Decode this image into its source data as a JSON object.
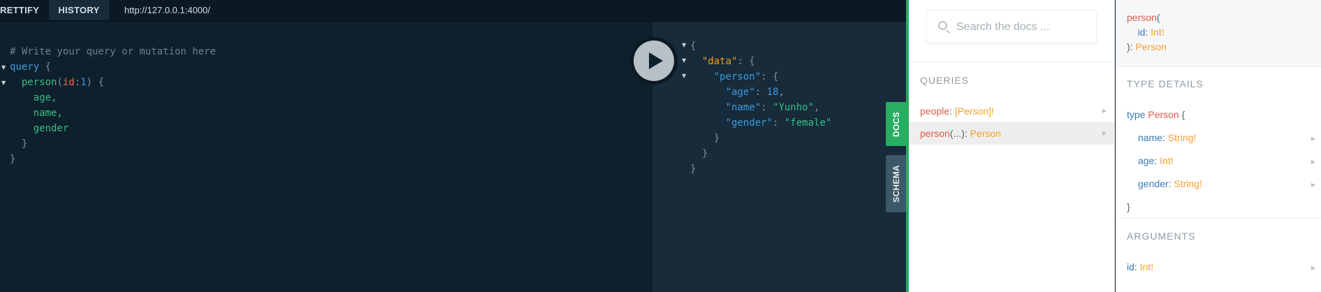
{
  "toolbar": {
    "prettify_label": "RETTIFY",
    "history_label": "HISTORY",
    "url": "http://127.0.0.1:4000/"
  },
  "query_editor": {
    "comment": "# Write your query or mutation here",
    "keyword": "query",
    "open_brace": " {",
    "field": "person",
    "arg_open": "(",
    "arg_name": "id",
    "arg_colon": ":",
    "arg_value": "1",
    "arg_close": ") {",
    "sub_fields": [
      "age,",
      "name,",
      "gender"
    ],
    "close_inner": "}",
    "close_outer": "}"
  },
  "result": {
    "open": "{",
    "data_key": "\"data\"",
    "person_key": "\"person\"",
    "age_key": "\"age\"",
    "age_value": "18",
    "name_key": "\"name\"",
    "name_value": "\"Yunho\"",
    "gender_key": "\"gender\"",
    "gender_value": "\"female\"",
    "colon_brace": ": {",
    "colon": ": ",
    "comma": ",",
    "close": "}"
  },
  "side_tabs": {
    "docs": "DOCS",
    "schema": "SCHEMA"
  },
  "docs": {
    "search_placeholder": "Search the docs ...",
    "queries_title": "QUERIES",
    "queries": [
      {
        "name": "people",
        "sep": ": ",
        "type": "[Person]!"
      },
      {
        "name": "person",
        "args": "(...)",
        "sep": ": ",
        "type": "Person"
      }
    ],
    "signature": {
      "name": "person",
      "open": "(",
      "arg_name": "id",
      "arg_sep": ": ",
      "arg_type": "Int!",
      "close": "): ",
      "return_type": "Person"
    },
    "type_details_title": "TYPE DETAILS",
    "type_keyword": "type",
    "type_name": "Person",
    "type_open": " {",
    "type_fields": [
      {
        "name": "name",
        "sep": ": ",
        "type": "String!"
      },
      {
        "name": "age",
        "sep": ": ",
        "type": "Int!"
      },
      {
        "name": "gender",
        "sep": ": ",
        "type": "String!"
      }
    ],
    "type_close": "}",
    "arguments_title": "ARGUMENTS",
    "arguments": [
      {
        "name": "id",
        "sep": ": ",
        "type": "Int!"
      }
    ]
  },
  "colors": {
    "docs_tab": "#27ae60",
    "schema_tab": "#3d5866",
    "editor_bg": "#0f202d",
    "result_bg": "#172b3a"
  }
}
